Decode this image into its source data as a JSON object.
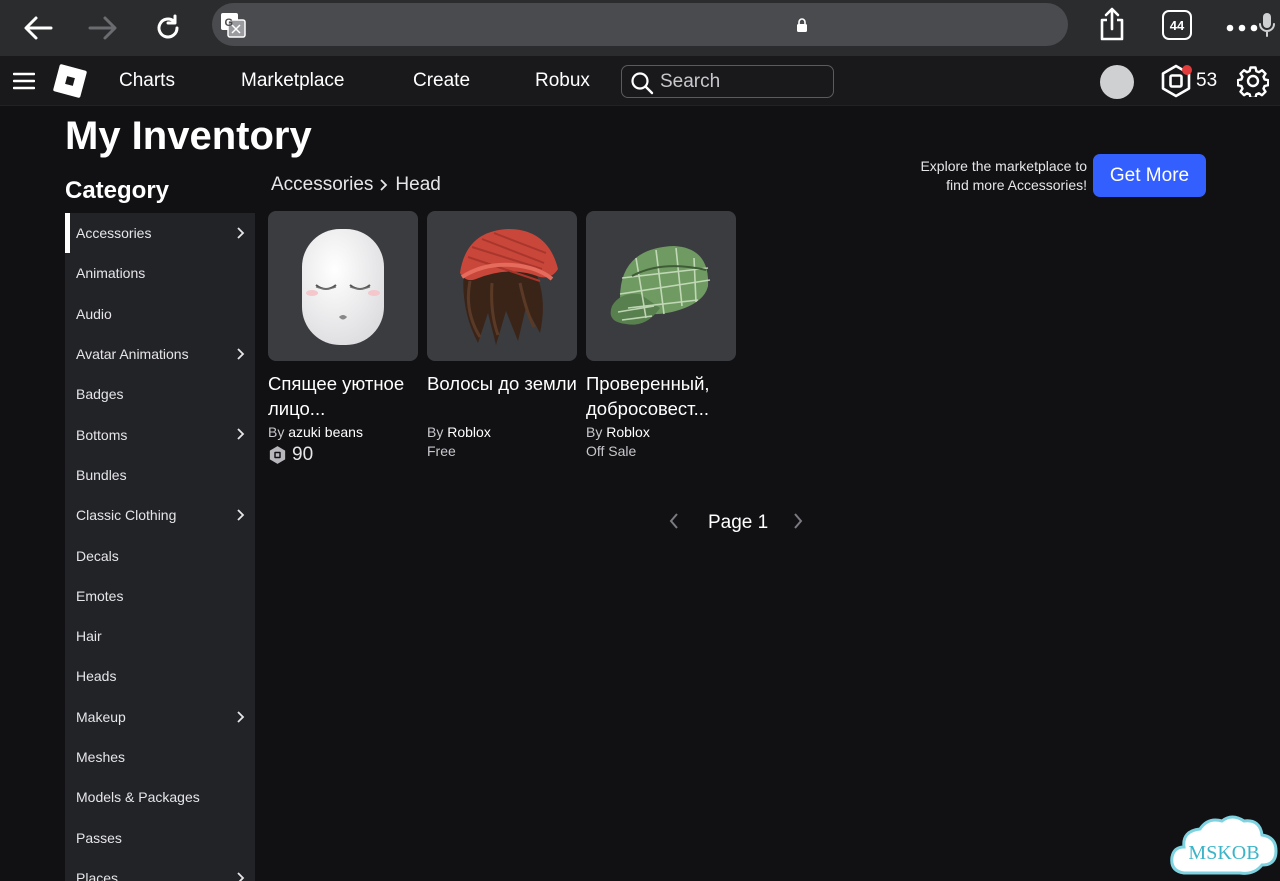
{
  "browser": {
    "tabs_count": "44"
  },
  "nav": {
    "links": [
      "Charts",
      "Marketplace",
      "Create",
      "Robux"
    ],
    "search_placeholder": "Search",
    "robux_balance": "53"
  },
  "page": {
    "title": "My Inventory",
    "category_heading": "Category",
    "breadcrumb": [
      "Accessories",
      "Head"
    ],
    "explore_text": "Explore the marketplace to find more Accessories!",
    "get_more_label": "Get More"
  },
  "sidebar": {
    "items": [
      {
        "label": "Accessories",
        "has_submenu": true,
        "active": true
      },
      {
        "label": "Animations",
        "has_submenu": false
      },
      {
        "label": "Audio",
        "has_submenu": false
      },
      {
        "label": "Avatar Animations",
        "has_submenu": true
      },
      {
        "label": "Badges",
        "has_submenu": false
      },
      {
        "label": "Bottoms",
        "has_submenu": true
      },
      {
        "label": "Bundles",
        "has_submenu": false
      },
      {
        "label": "Classic Clothing",
        "has_submenu": true
      },
      {
        "label": "Decals",
        "has_submenu": false
      },
      {
        "label": "Emotes",
        "has_submenu": false
      },
      {
        "label": "Hair",
        "has_submenu": false
      },
      {
        "label": "Heads",
        "has_submenu": false
      },
      {
        "label": "Makeup",
        "has_submenu": true
      },
      {
        "label": "Meshes",
        "has_submenu": false
      },
      {
        "label": "Models & Packages",
        "has_submenu": false
      },
      {
        "label": "Passes",
        "has_submenu": false
      },
      {
        "label": "Places",
        "has_submenu": true
      }
    ]
  },
  "items": [
    {
      "name": "Спящее уютное лицо...",
      "by_prefix": "By",
      "creator": "azuki beans",
      "price": "90",
      "price_type": "robux",
      "thumb_icon": "sleepy-face-icon"
    },
    {
      "name": "Волосы до земли",
      "by_prefix": "By",
      "creator": "Roblox",
      "price": "Free",
      "price_type": "text",
      "thumb_icon": "long-hair-red-beanie-icon"
    },
    {
      "name": "Проверенный, добросовест...",
      "by_prefix": "By",
      "creator": "Roblox",
      "price": "Off Sale",
      "price_type": "text",
      "thumb_icon": "green-plaid-cap-icon"
    }
  ],
  "pagination": {
    "label": "Page 1"
  },
  "watermark": {
    "text": "MSKOB"
  },
  "colors": {
    "background": "#111114",
    "sidebar": "#222327",
    "accent_blue": "#335fff",
    "card_thumb": "#3b3c40"
  }
}
